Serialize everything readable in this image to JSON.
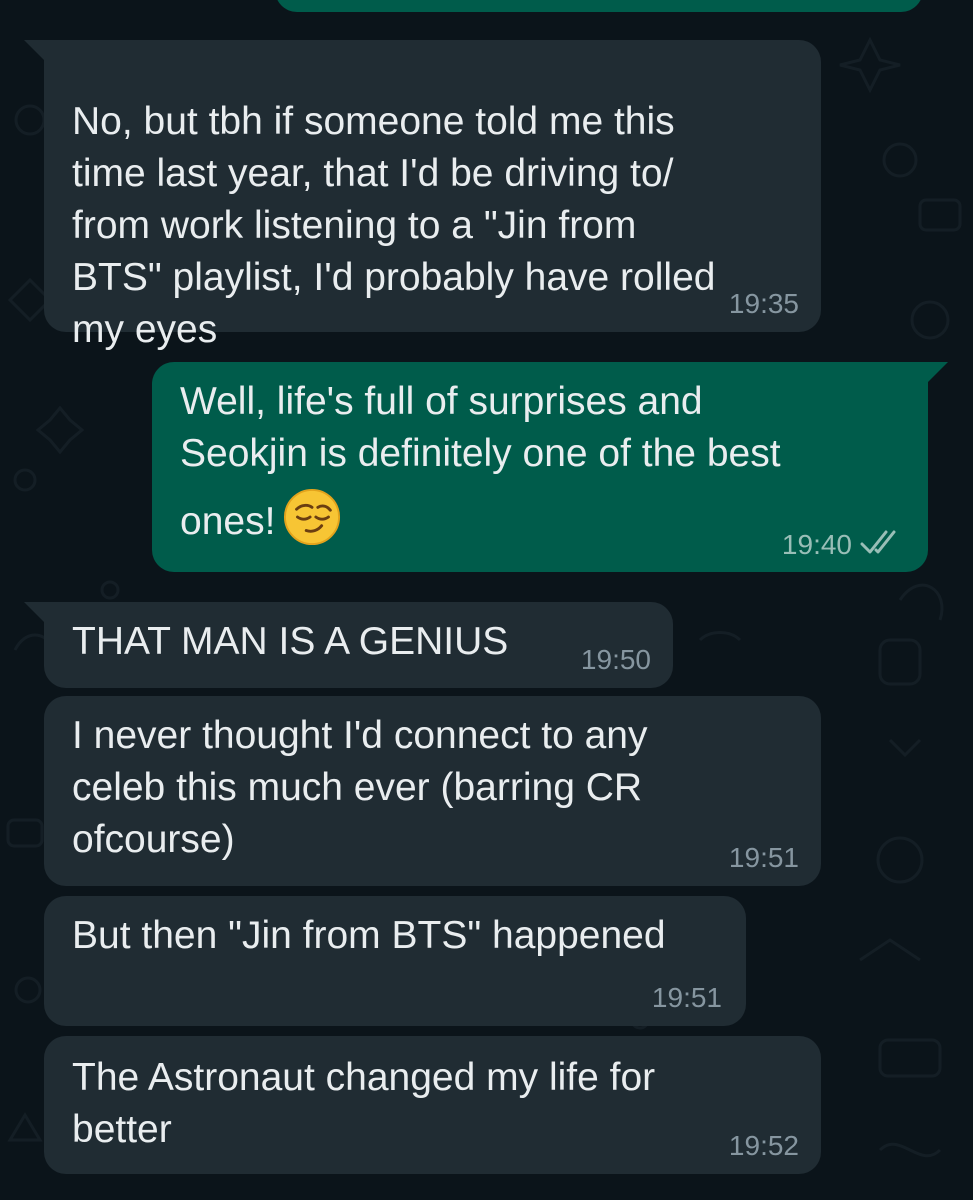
{
  "messages": [
    {
      "direction": "incoming",
      "lines": [
        "No, but tbh if someone told me this",
        "time last year, that I'd be driving to/",
        "from work listening to a \"Jin from",
        "BTS\" playlist, I'd probably have rolled",
        "my eyes"
      ],
      "time": "19:35"
    },
    {
      "direction": "outgoing",
      "lines": [
        "Well, life's full of surprises and",
        "Seokjin is definitely one of the best",
        "ones!"
      ],
      "emoji": "smirking-face-emoji",
      "time": "19:40",
      "status_icon": "double-check-icon"
    },
    {
      "direction": "incoming",
      "lines": [
        "THAT MAN IS A GENIUS"
      ],
      "time": "19:50"
    },
    {
      "direction": "incoming",
      "lines": [
        "I never thought I'd connect to any",
        "celeb this much ever (barring CR",
        "ofcourse)"
      ],
      "time": "19:51"
    },
    {
      "direction": "incoming",
      "lines": [
        "But then \"Jin from BTS\" happened"
      ],
      "time": "19:51"
    },
    {
      "direction": "incoming",
      "lines": [
        "The Astronaut changed my life for",
        "better"
      ],
      "time": "19:52"
    }
  ],
  "colors": {
    "background": "#0b141a",
    "incoming_bubble": "#202c33",
    "outgoing_bubble": "#005c4b",
    "text": "#e9edef",
    "timestamp": "#8696a0",
    "tick": "#99beb7"
  }
}
